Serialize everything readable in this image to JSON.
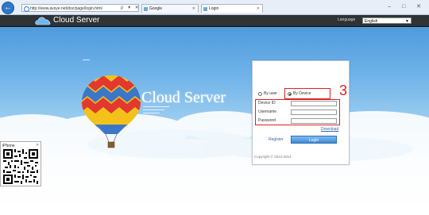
{
  "browser": {
    "back_glyph": "←",
    "url": "http://www.avsye.net/doc/page/login.html",
    "address_tools": "ρ ▾ ✕ ⟳",
    "tabs": [
      {
        "label": "Google",
        "close": "✕"
      },
      {
        "label": "Login",
        "close": "✕"
      }
    ],
    "window_controls": "– □ ✕"
  },
  "header": {
    "app_title": "Cloud Server",
    "language_label": "Language",
    "language_value": "English",
    "language_caret": "▼"
  },
  "hero": {
    "title": "Cloud Server"
  },
  "login": {
    "by_user_label": "By user",
    "by_device_label": "By Device",
    "selected_mode": "By Device",
    "device_id_label": "Device ID",
    "username_label": "Username",
    "password_label": "Password",
    "device_id_value": "",
    "username_value": "",
    "password_value": "",
    "download_label": "Download",
    "register_label": "Register",
    "login_button_label": "Login",
    "copyright": "Copyright © 2012-2014"
  },
  "annotation": {
    "number": "3",
    "color": "#dd2222"
  },
  "qr_panel": {
    "label": "iPhone",
    "close": "✕"
  },
  "icons": {
    "back": "back-arrow-icon",
    "logo": "cloud-icon",
    "balloon": "hot-air-balloon-icon",
    "qr": "qr-code-icon"
  }
}
